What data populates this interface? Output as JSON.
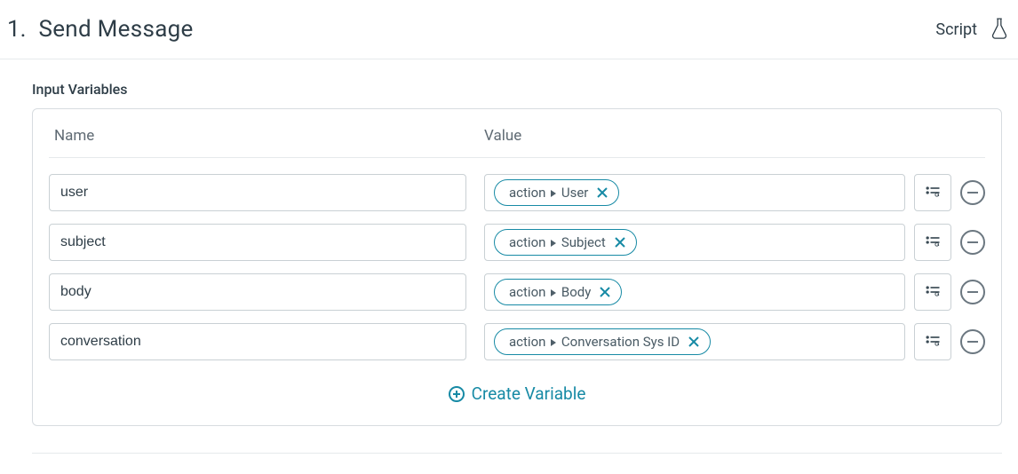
{
  "header": {
    "step_number": "1.",
    "title": "Send Message",
    "script_label": "Script"
  },
  "section": {
    "label": "Input Variables",
    "columns": {
      "name": "Name",
      "value": "Value"
    },
    "create_label": "Create Variable"
  },
  "rows": [
    {
      "name": "user",
      "pill_prefix": "action",
      "pill_field": "User"
    },
    {
      "name": "subject",
      "pill_prefix": "action",
      "pill_field": "Subject"
    },
    {
      "name": "body",
      "pill_prefix": "action",
      "pill_field": "Body"
    },
    {
      "name": "conversation",
      "pill_prefix": "action",
      "pill_field": "Conversation Sys ID"
    }
  ]
}
